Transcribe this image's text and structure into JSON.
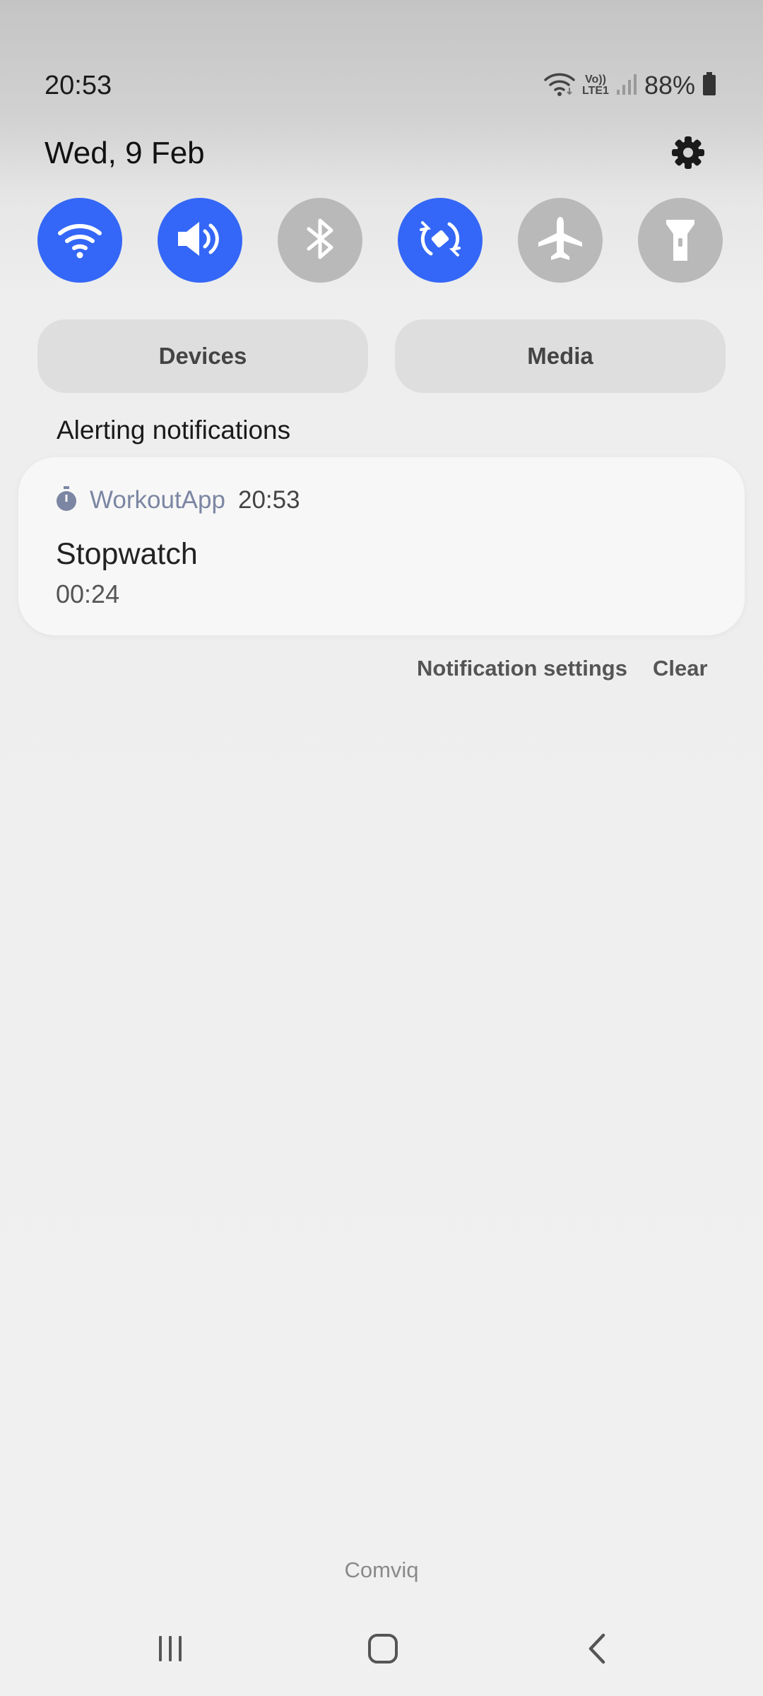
{
  "status_bar": {
    "time": "20:53",
    "battery_percent": "88%",
    "network_label_top": "Vo))",
    "network_label_bottom": "LTE1",
    "icons": [
      "wifi-signal-icon",
      "volte-lte-icon",
      "cell-signal-icon",
      "battery-icon"
    ]
  },
  "header": {
    "date": "Wed, 9 Feb",
    "settings_icon": "gear-icon"
  },
  "quick_toggles": [
    {
      "name": "wifi",
      "icon": "wifi-icon",
      "state": "on"
    },
    {
      "name": "sound",
      "icon": "speaker-icon",
      "state": "on"
    },
    {
      "name": "bluetooth",
      "icon": "bluetooth-icon",
      "state": "off"
    },
    {
      "name": "auto-rotate",
      "icon": "rotate-icon",
      "state": "on"
    },
    {
      "name": "airplane-mode",
      "icon": "airplane-icon",
      "state": "off"
    },
    {
      "name": "flashlight",
      "icon": "flashlight-icon",
      "state": "off"
    }
  ],
  "panels": {
    "devices_label": "Devices",
    "media_label": "Media"
  },
  "notifications": {
    "section_title": "Alerting notifications",
    "items": [
      {
        "app_name": "WorkoutApp",
        "time": "20:53",
        "icon": "stopwatch-icon",
        "title": "Stopwatch",
        "text": "00:24"
      }
    ],
    "settings_label": "Notification settings",
    "clear_label": "Clear"
  },
  "carrier": "Comviq",
  "navigation": {
    "recents_icon": "recents-icon",
    "home_icon": "home-icon",
    "back_icon": "back-icon"
  },
  "colors": {
    "accent": "#3467f7",
    "toggle_off": "#b9b9b9",
    "app_name": "#7b86a3"
  }
}
